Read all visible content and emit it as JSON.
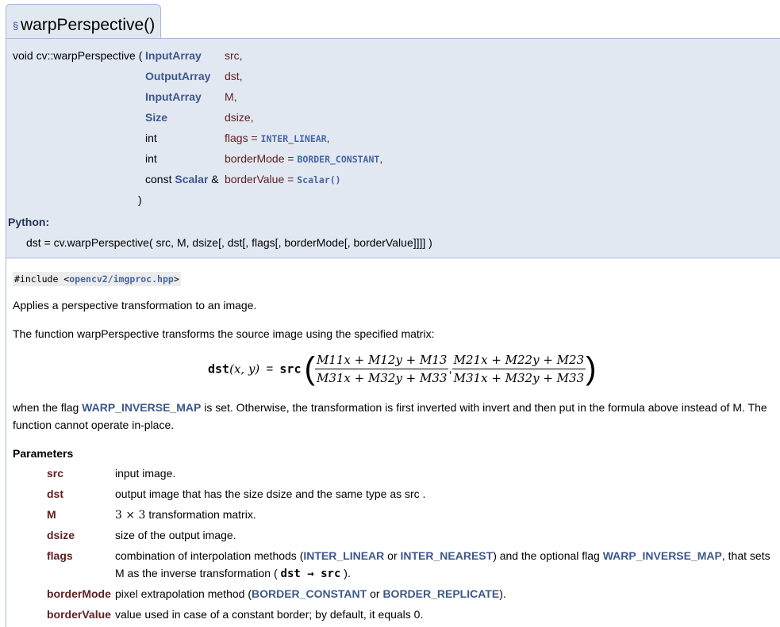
{
  "header": {
    "section_symbol": "§",
    "title": "warpPerspective()"
  },
  "prototype": {
    "return_and_name": "void cv::warpPerspective (",
    "params": [
      {
        "type": "InputArray",
        "name": "src",
        "sep": ","
      },
      {
        "type": "OutputArray",
        "name": "dst",
        "sep": ","
      },
      {
        "type": "InputArray",
        "name": "M",
        "sep": ","
      },
      {
        "type": "Size",
        "name": "dsize",
        "sep": ","
      },
      {
        "type": "int",
        "name": "flags",
        "default": "INTER_LINEAR",
        "sep": ","
      },
      {
        "type": "int",
        "name": "borderMode",
        "default": "BORDER_CONSTANT",
        "sep": ","
      },
      {
        "type_prefix": "const ",
        "type": "Scalar",
        "type_suffix": " &",
        "name": "borderValue",
        "default": "Scalar()",
        "sep": ""
      }
    ],
    "close_paren": ")",
    "python_label": "Python:",
    "python_sig": "dst = cv.warpPerspective( src, M, dsize[, dst[, flags[, borderMode[, borderValue]]]] )"
  },
  "doc": {
    "include_prefix": "#include <",
    "include_file": "opencv2/imgproc.hpp",
    "include_suffix": ">",
    "brief": "Applies a perspective transformation to an image.",
    "intro": "The function warpPerspective transforms the source image using the specified matrix:",
    "formula": {
      "lhs": "dst",
      "args": "(x, y)",
      "eq": "=",
      "fn": "src",
      "num1": "M11x + M12y + M13",
      "den1": "M31x + M32y + M33",
      "num2": "M21x + M22y + M23",
      "den2": "M31x + M32y + M33"
    },
    "flag_text_pre": "when the flag ",
    "flag_link": "WARP_INVERSE_MAP",
    "flag_text_post": " is set. Otherwise, the transformation is first inverted with invert and then put in the formula above instead of M. The",
    "flag_text_line2": "function cannot operate in-place.",
    "params_heading": "Parameters",
    "params": [
      {
        "name": "src",
        "desc": "input image."
      },
      {
        "name": "dst",
        "desc": "output image that has the size dsize and the same type as src ."
      },
      {
        "name": "M",
        "desc_math": "3 × 3",
        "desc": " transformation matrix."
      },
      {
        "name": "dsize",
        "desc": "size of the output image."
      },
      {
        "name": "flags",
        "desc_pre": "combination of interpolation methods (",
        "link1": "INTER_LINEAR",
        "mid1": " or ",
        "link2": "INTER_NEAREST",
        "mid2": ") and the optional flag ",
        "link3": "WARP_INVERSE_MAP",
        "post": ", that sets",
        "line2_pre": "M as the inverse transformation ( ",
        "line2_math": "dst → src",
        "line2_post": " )."
      },
      {
        "name": "borderMode",
        "desc_pre": "pixel extrapolation method (",
        "link1": "BORDER_CONSTANT",
        "mid1": " or ",
        "link2": "BORDER_REPLICATE",
        "post": ")."
      },
      {
        "name": "borderValue",
        "desc": "value used in case of a constant border; by default, it equals 0."
      }
    ]
  }
}
